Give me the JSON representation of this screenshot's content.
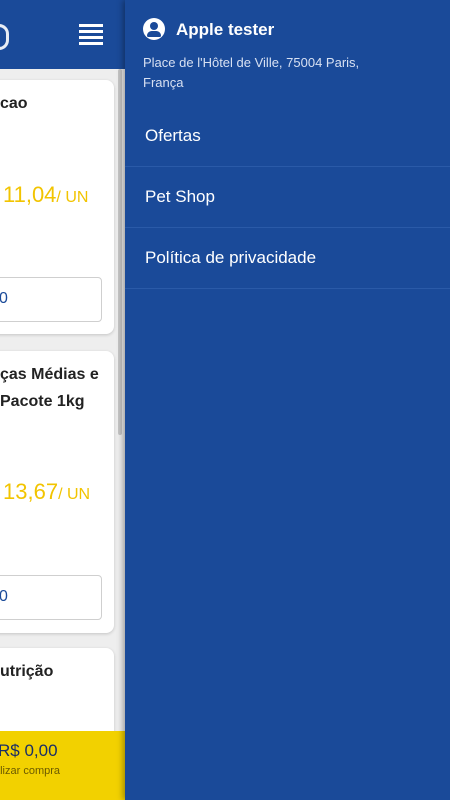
{
  "products": [
    {
      "title_line1": "cao",
      "title_line2": "",
      "price": "11,04",
      "unit": "/ UN",
      "qty": "0"
    },
    {
      "title_line1": "ças Médias e",
      "title_line2": "Pacote 1kg",
      "price": "13,67",
      "unit": "/ UN",
      "qty": "0"
    },
    {
      "title_line1": "utrição",
      "title_line2": ""
    }
  ],
  "cart": {
    "total": "R$ 0,00",
    "hint": "alizar compra"
  },
  "drawer": {
    "user_name": "Apple tester",
    "address": "Place de l'Hôtel de Ville, 75004 Paris, França",
    "menu": [
      {
        "label": "Ofertas"
      },
      {
        "label": "Pet Shop"
      },
      {
        "label": "Política de privacidade"
      }
    ]
  },
  "colors": {
    "brand_blue": "#1a4a99",
    "price_yellow": "#f2c400",
    "cart_yellow": "#f2d100"
  },
  "icons": {
    "menu": "hamburger-icon",
    "user": "account-circle-icon"
  }
}
